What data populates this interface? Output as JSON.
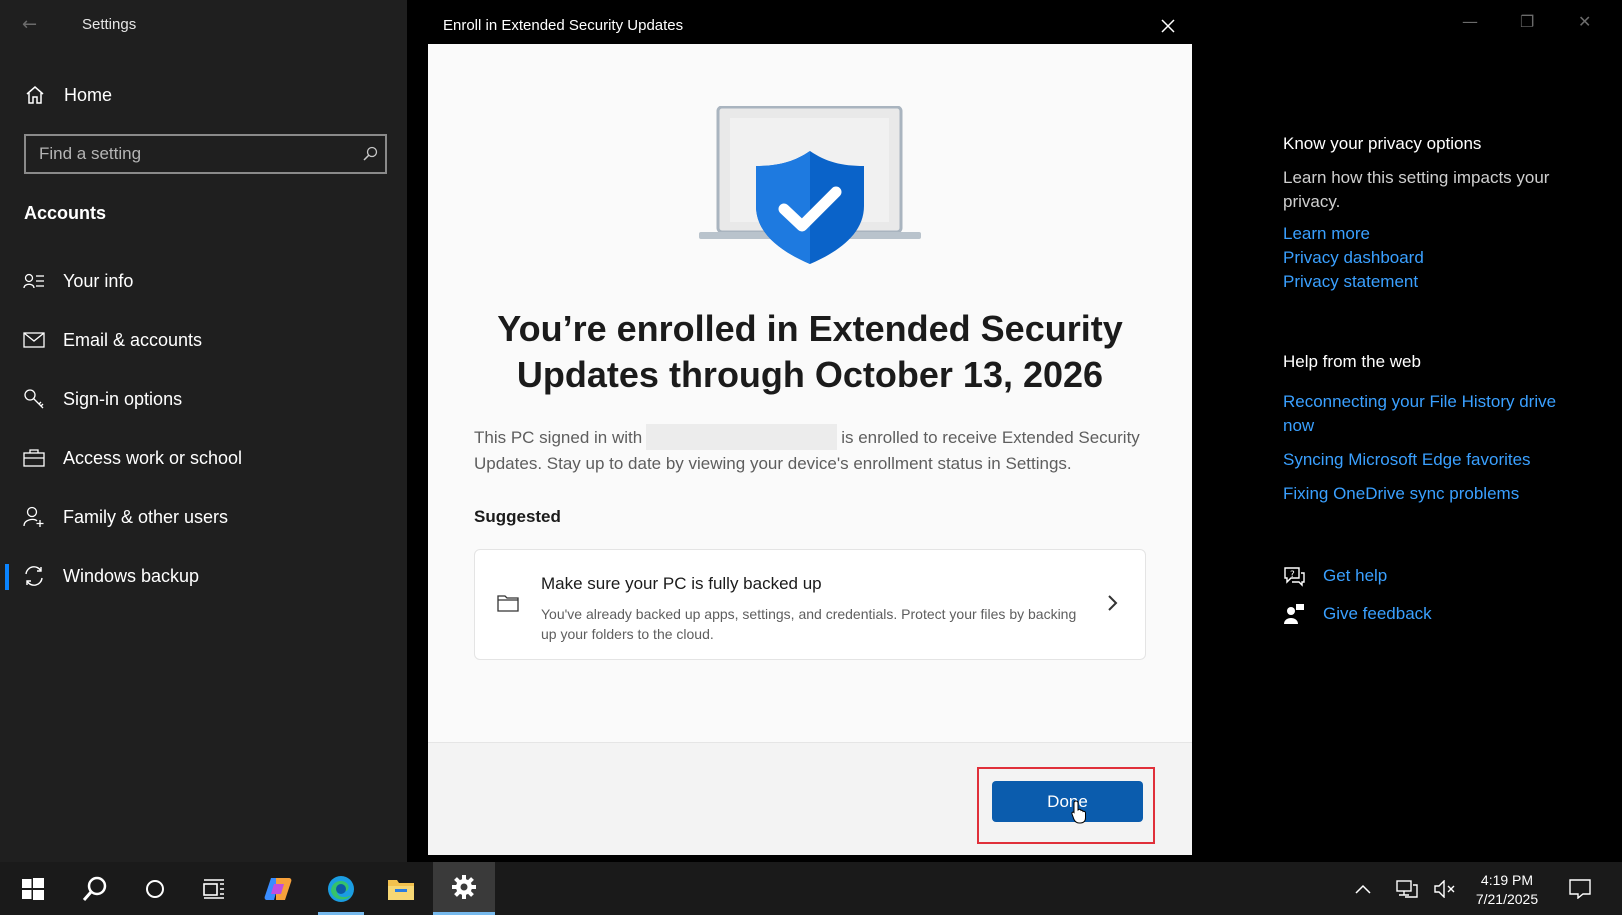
{
  "window": {
    "app_title": "Settings",
    "nav_home": "Home",
    "search_placeholder": "Find a setting",
    "section_title": "Accounts",
    "nav_items": [
      {
        "label": "Your info",
        "icon": "person-card-icon"
      },
      {
        "label": "Email & accounts",
        "icon": "mail-icon"
      },
      {
        "label": "Sign-in options",
        "icon": "key-icon"
      },
      {
        "label": "Access work or school",
        "icon": "briefcase-icon"
      },
      {
        "label": "Family & other users",
        "icon": "person-add-icon"
      },
      {
        "label": "Windows backup",
        "icon": "sync-icon",
        "selected": true
      }
    ]
  },
  "side_panel": {
    "privacy_heading": "Know your privacy options",
    "privacy_text": "Learn how this setting impacts your privacy.",
    "privacy_links": [
      "Learn more",
      "Privacy dashboard",
      "Privacy statement"
    ],
    "web_heading": "Help from the web",
    "web_links": [
      "Reconnecting your File History drive now",
      "Syncing Microsoft Edge favorites",
      "Fixing OneDrive sync problems"
    ],
    "get_help": "Get help",
    "give_feedback": "Give feedback"
  },
  "dialog": {
    "title": "Enroll in Extended Security Updates",
    "heading": "You’re enrolled in Extended Security Updates through October 13, 2026",
    "body_before": "This PC signed in with",
    "body_after": "is enrolled to receive Extended Security Updates. Stay up to date by viewing your device's enrollment status in Settings.",
    "suggested_label": "Suggested",
    "card_title": "Make sure your PC is fully backed up",
    "card_desc": "You've already backed up apps, settings, and credentials. Protect your files by backing up your folders to the cloud.",
    "done_label": "Done"
  },
  "taskbar": {
    "time": "4:19 PM",
    "date": "7/21/2025"
  },
  "colors": {
    "accent": "#0b5cad",
    "link": "#3aa0ff",
    "highlight": "#e0303a"
  }
}
